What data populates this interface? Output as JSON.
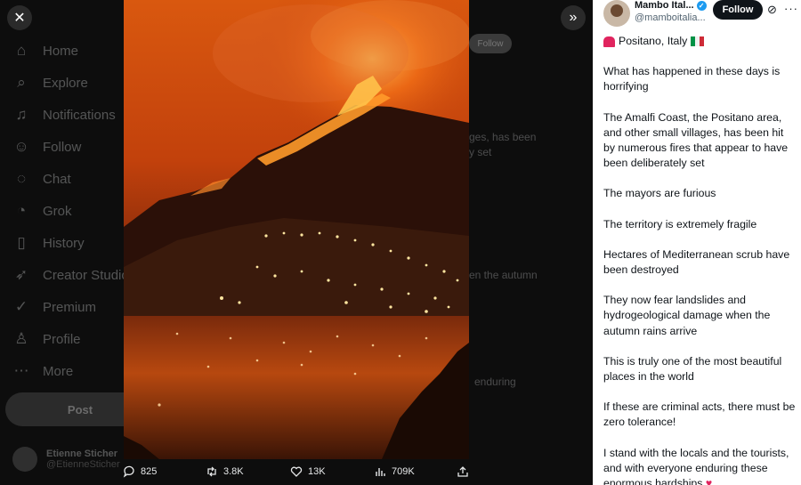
{
  "nav": {
    "items": [
      {
        "label": "Home",
        "icon": "home-icon",
        "glyph": "⌂"
      },
      {
        "label": "Explore",
        "icon": "search-icon",
        "glyph": "⌕"
      },
      {
        "label": "Notifications",
        "icon": "bell-icon",
        "glyph": "♫"
      },
      {
        "label": "Follow",
        "icon": "add-user-icon",
        "glyph": "☺"
      },
      {
        "label": "Chat",
        "icon": "chat-icon",
        "glyph": "◌"
      },
      {
        "label": "Grok",
        "icon": "grok-icon",
        "glyph": "◔"
      },
      {
        "label": "History",
        "icon": "bookmark-icon",
        "glyph": "▯"
      },
      {
        "label": "Creator Studio",
        "icon": "rocket-icon",
        "glyph": "➶"
      },
      {
        "label": "Premium",
        "icon": "verified-icon",
        "glyph": "✓"
      },
      {
        "label": "Profile",
        "icon": "person-icon",
        "glyph": "♙"
      },
      {
        "label": "More",
        "icon": "more-circle-icon",
        "glyph": "⋯"
      }
    ],
    "post_label": "Post",
    "account": {
      "name": "Etienne Sticher",
      "handle": "@EtienneSticher"
    }
  },
  "background_post": {
    "follow_label": "Follow",
    "snippets": [
      "ges, has been",
      "y set",
      "en the autumn",
      "enduring"
    ]
  },
  "controls": {
    "close_glyph": "✕",
    "expand_glyph": "»"
  },
  "actions": {
    "replies": "825",
    "reposts": "3.8K",
    "likes": "13K",
    "views": "709K"
  },
  "panel": {
    "name": "Mambo Ital...",
    "handle": "@mamboitalia...",
    "follow_label": "Follow",
    "location_line": "Positano, Italy",
    "paragraphs": [
      "What has happened in these days is horrifying",
      "The Amalfi Coast, the Positano area, and other small villages, has been hit by numerous fires that appear to have been deliberately set",
      "The mayors are furious",
      "The territory is extremely fragile",
      "Hectares of Mediterranean scrub have been destroyed",
      "They now fear landslides and hydrogeological damage when the autumn rains arrive",
      "This is truly one of the most beautiful places in the world",
      "If these are criminal acts, there must be zero tolerance!",
      "I stand with the locals and the tourists, and with everyone enduring these enormous hardships"
    ]
  },
  "colors": {
    "panel_bg": "#ffffff",
    "overlay_bg": "#0d0d0d",
    "fire": "#ff7a1a",
    "sky": "#c2410c",
    "verified": "#1d9bf0"
  }
}
